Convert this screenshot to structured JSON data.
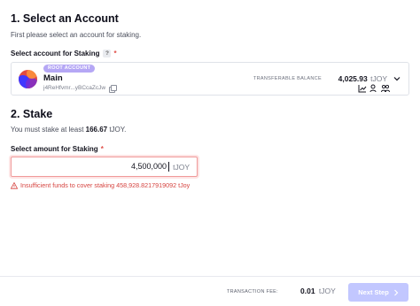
{
  "section1": {
    "title": "1. Select an Account",
    "subtitle": "First please select an account for staking."
  },
  "account_field": {
    "label": "Select account for Staking",
    "help": "?",
    "required_mark": "*"
  },
  "account": {
    "badge": "ROOT ACCOUNT",
    "name": "Main",
    "address": "j4ReHfvmr...yBCcaZcJw",
    "balance_label": "TRANSFERABLE BALANCE",
    "balance_value": "4,025.93",
    "balance_unit": "tJOY"
  },
  "section2": {
    "title": "2. Stake",
    "min_prefix": "You must stake at least ",
    "min_value": "166.67",
    "min_unit": " tJOY."
  },
  "amount_field": {
    "label": "Select amount for Staking",
    "required_mark": "*",
    "value": "4,500,000",
    "unit": "tJOY",
    "error": "Insufficient funds to cover staking 458,928.8217919092 tJoy"
  },
  "footer": {
    "fee_label": "TRANSACTION FEE:",
    "fee_value": "0.01",
    "fee_unit": "tJOY",
    "next_label": "Next Step",
    "next_icon": "chevron-right-icon"
  },
  "colors": {
    "badge": "#b5a7f5",
    "error": "#d64541",
    "next_button_disabled": "#c2c7ff"
  }
}
